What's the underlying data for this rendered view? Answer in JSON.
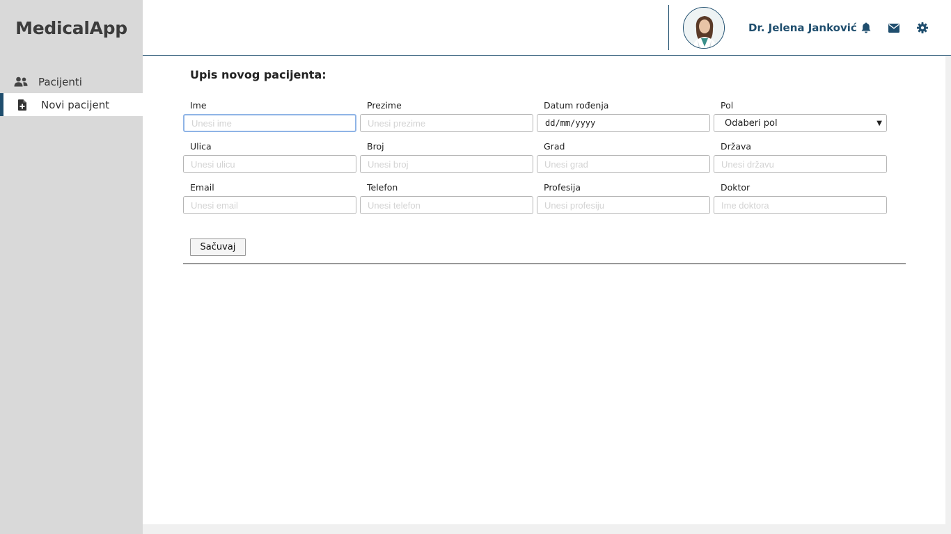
{
  "app": {
    "brand": "MedicalApp"
  },
  "sidebar": {
    "items": [
      {
        "label": "Pacijenti",
        "icon": "users-icon",
        "active": false
      },
      {
        "label": "Novi pacijent",
        "icon": "file-medical-icon",
        "active": true
      }
    ]
  },
  "header": {
    "user_name": "Dr. Jelena Janković",
    "icons": [
      "bell-icon",
      "envelope-icon",
      "gear-icon"
    ]
  },
  "form": {
    "title": "Upis novog pacijenta:",
    "fields": {
      "ime": {
        "label": "Ime",
        "placeholder": "Unesi ime"
      },
      "prezime": {
        "label": "Prezime",
        "placeholder": "Unesi prezime"
      },
      "datum": {
        "label": "Datum rođenja",
        "value": "dd/mm/yyyy"
      },
      "pol": {
        "label": "Pol",
        "value": "Odaberi pol"
      },
      "ulica": {
        "label": "Ulica",
        "placeholder": "Unesi ulicu"
      },
      "broj": {
        "label": "Broj",
        "placeholder": "Unesi broj"
      },
      "grad": {
        "label": "Grad",
        "placeholder": "Unesi grad"
      },
      "drzava": {
        "label": "Država",
        "placeholder": "Unesi državu"
      },
      "email": {
        "label": "Email",
        "placeholder": "Unesi email"
      },
      "telefon": {
        "label": "Telefon",
        "placeholder": "Unesi telefon"
      },
      "profesija": {
        "label": "Profesija",
        "placeholder": "Unesi profesiju"
      },
      "doktor": {
        "label": "Doktor",
        "placeholder": "Ime doktora"
      }
    },
    "save_label": "Sačuvaj"
  },
  "colors": {
    "accent": "#1f4e6e",
    "sidebar_bg": "#d9d9d9",
    "focus_border": "#8fb4e6"
  }
}
